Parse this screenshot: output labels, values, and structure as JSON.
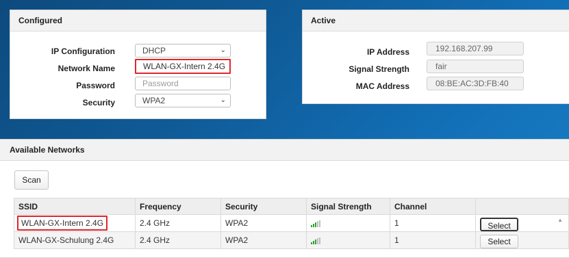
{
  "configured": {
    "title": "Configured",
    "ip_configuration_label": "IP Configuration",
    "ip_configuration_value": "DHCP",
    "network_name_label": "Network Name",
    "network_name_value": "WLAN-GX-Intern 2.4G",
    "password_label": "Password",
    "password_placeholder": "Password",
    "security_label": "Security",
    "security_value": "WPA2"
  },
  "active": {
    "title": "Active",
    "ip_address_label": "IP Address",
    "ip_address_value": "192.168.207.99",
    "signal_strength_label": "Signal Strength",
    "signal_strength_value": "fair",
    "mac_address_label": "MAC Address",
    "mac_address_value": "08:BE:AC:3D:FB:40"
  },
  "available": {
    "title": "Available Networks",
    "scan_label": "Scan",
    "columns": [
      "SSID",
      "Frequency",
      "Security",
      "Signal Strength",
      "Channel",
      ""
    ],
    "rows": [
      {
        "ssid": "WLAN-GX-Intern 2.4G",
        "frequency": "2.4 GHz",
        "security": "WPA2",
        "signal_bars": 3,
        "channel": "1",
        "action": "Select"
      },
      {
        "ssid": "WLAN-GX-Schulung 2.4G",
        "frequency": "2.4 GHz",
        "security": "WPA2",
        "signal_bars": 3,
        "channel": "1",
        "action": "Select"
      }
    ]
  },
  "colors": {
    "highlight": "#e0262a",
    "signal": "#2aa52a"
  },
  "icons": {
    "dropdown": "chevron-down-icon",
    "scroll": "scroll-up-arrow-icon",
    "signal": "signal-bars-icon"
  }
}
